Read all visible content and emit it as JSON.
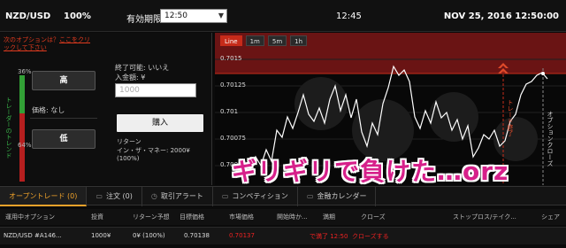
{
  "top": {
    "pair": "NZD/USD",
    "percent": "100%",
    "expiry_label": "有効期限:",
    "expiry_value": "12:50",
    "clock": "12:45",
    "datetime": "NOV 25, 2016 12:50:00"
  },
  "left": {
    "next_option": "次のオプションは？",
    "click_here": "ここをクリックして下さい",
    "trend_top_pct": "36%",
    "trend_bottom_pct": "64%",
    "trend_label": "トレーダーのトレンド",
    "trend_up_fraction": 0.36,
    "high_label": "高",
    "low_label": "低",
    "price_label": "価格: なし",
    "early_close": "終了可能: いいえ",
    "amount_label": "入金額: ¥",
    "amount_placeholder": "1000",
    "buy_label": "購入",
    "return_label": "リターン",
    "return_value": "イン・ザ・マネー: 2000¥ (100%)"
  },
  "chart": {
    "tabs": [
      "Line",
      "1m",
      "5m",
      "1h"
    ],
    "active_tab": "Line",
    "y_labels": [
      "0.7015",
      "0.70125",
      "0.701",
      "0.70075",
      "0.7005"
    ],
    "expiry_marker": "トレード終了",
    "option_close_marker": "オプションクローズ",
    "colors": {
      "zone": "#6a1414",
      "line": "#ffffff",
      "accent": "#c62b1a"
    }
  },
  "overlay_text": "ギリギリで負けた…orz",
  "tabs": [
    {
      "label": "オープントレード (0)",
      "icon": ""
    },
    {
      "label": "注文 (0)",
      "icon": "▭"
    },
    {
      "label": "取引アラート",
      "icon": "◷"
    },
    {
      "label": "コンペティション",
      "icon": "▭"
    },
    {
      "label": "金融カレンダー",
      "icon": "▭"
    }
  ],
  "table": {
    "headers": [
      "運用中オプション",
      "投資",
      "リターン予想",
      "目標価格",
      "市場価格",
      "開始時か...",
      "満期",
      "クローズ",
      "ストップロス/テイク...",
      "シェア"
    ],
    "row": {
      "asset": "NZD/USD #A146...",
      "invest": "1000¥",
      "return": "0¥ (100%)",
      "target": "0.70138",
      "market": "0.70137",
      "expiry": "で満了 12:50",
      "close": "クローズする"
    }
  }
}
